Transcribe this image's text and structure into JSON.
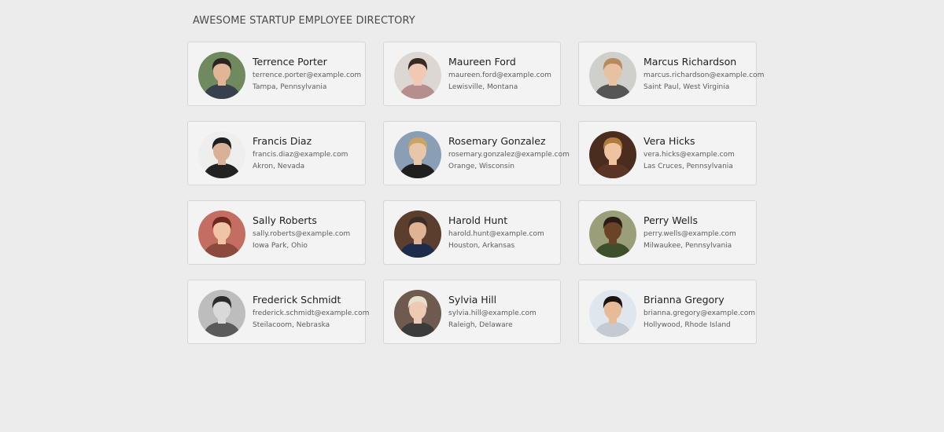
{
  "header": {
    "title": "AWESOME STARTUP EMPLOYEE DIRECTORY"
  },
  "employees": [
    {
      "name": "Terrence Porter",
      "email": "terrence.porter@example.com",
      "location": "Tampa, Pennsylvania",
      "photo": "portrait-man-short-dark-hair",
      "bg": "#6f8a5e",
      "skin": "#e2b596",
      "hair": "#2b2420",
      "shirt": "#37414d"
    },
    {
      "name": "Maureen Ford",
      "email": "maureen.ford@example.com",
      "location": "Lewisville, Montana",
      "photo": "portrait-woman-dark-bob",
      "bg": "#ddd7d3",
      "skin": "#f0c8b4",
      "hair": "#3a2a22",
      "shirt": "#b78e8e"
    },
    {
      "name": "Marcus Richardson",
      "email": "marcus.richardson@example.com",
      "location": "Saint Paul, West Virginia",
      "photo": "portrait-man-beard",
      "bg": "#cfcfcb",
      "skin": "#e8c1a2",
      "hair": "#b98a5d",
      "shirt": "#555555"
    },
    {
      "name": "Francis Diaz",
      "email": "francis.diaz@example.com",
      "location": "Akron, Nevada",
      "photo": "portrait-man-sunglasses",
      "bg": "#eeeeee",
      "skin": "#d8b196",
      "hair": "#1e1e1e",
      "shirt": "#222222"
    },
    {
      "name": "Rosemary Gonzalez",
      "email": "rosemary.gonzalez@example.com",
      "location": "Orange, Wisconsin",
      "photo": "portrait-woman-outdoors-waterfront",
      "bg": "#8a9fb5",
      "skin": "#e9c6a9",
      "hair": "#c9a464",
      "shirt": "#1f1f1f"
    },
    {
      "name": "Vera Hicks",
      "email": "vera.hicks@example.com",
      "location": "Las Cruces, Pennsylvania",
      "photo": "portrait-woman-smiling-blonde",
      "bg": "#4a2d1f",
      "skin": "#efc3a0",
      "hair": "#b27a3c",
      "shirt": "#5a3526"
    },
    {
      "name": "Sally Roberts",
      "email": "sally.roberts@example.com",
      "location": "Iowa Park, Ohio",
      "photo": "portrait-woman-red-hair",
      "bg": "#c46d62",
      "skin": "#efc5a8",
      "hair": "#6b2a1c",
      "shirt": "#8b4a3c"
    },
    {
      "name": "Harold Hunt",
      "email": "harold.hunt@example.com",
      "location": "Houston, Arkansas",
      "photo": "portrait-man-suit-tie",
      "bg": "#5b3e2d",
      "skin": "#deb495",
      "hair": "#3b2e28",
      "shirt": "#1d2c4a"
    },
    {
      "name": "Perry Wells",
      "email": "perry.wells@example.com",
      "location": "Milwaukee, Pennsylvania",
      "photo": "portrait-man-smiling-outdoors",
      "bg": "#9a9f7a",
      "skin": "#6b4428",
      "hair": "#2a1c14",
      "shirt": "#3e4f2c"
    },
    {
      "name": "Frederick Schmidt",
      "email": "frederick.schmidt@example.com",
      "location": "Steilacoom, Nebraska",
      "photo": "portrait-man-black-and-white",
      "bg": "#bdbdbd",
      "skin": "#d9d9d9",
      "hair": "#2c2c2c",
      "shirt": "#5a5a5a"
    },
    {
      "name": "Sylvia Hill",
      "email": "sylvia.hill@example.com",
      "location": "Raleigh, Delaware",
      "photo": "portrait-woman-platinum-hair",
      "bg": "#6e5a4e",
      "skin": "#eccab4",
      "hair": "#e8e0cf",
      "shirt": "#3b3b3b"
    },
    {
      "name": "Brianna Gregory",
      "email": "brianna.gregory@example.com",
      "location": "Hollywood, Rhode Island",
      "photo": "portrait-woman-long-dark-hair",
      "bg": "#dfe6ee",
      "skin": "#e7bb98",
      "hair": "#1b1512",
      "shirt": "#c4c9d2"
    }
  ]
}
